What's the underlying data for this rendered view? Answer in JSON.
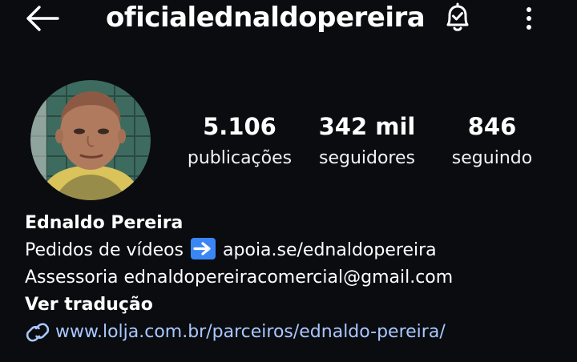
{
  "header": {
    "username": "oficialednaldopereira",
    "back_icon": "arrow-left-icon",
    "notification_icon": "bell-check-icon",
    "more_icon": "more-vertical-icon"
  },
  "profile": {
    "avatar_icon": "profile-photo",
    "stats": [
      {
        "value": "5.106",
        "label": "publicações"
      },
      {
        "value": "342 mil",
        "label": "seguidores"
      },
      {
        "value": "846",
        "label": "seguindo"
      }
    ]
  },
  "bio": {
    "name": "Ednaldo Pereira",
    "line1_before": "Pedidos de vídeos",
    "line1_emoji": "arrow-right-emoji",
    "line1_after": "apoia.se/ednaldopereira",
    "line2": "Assessoria ednaldopereiracomercial@gmail.com",
    "translate_label": "Ver tradução",
    "link_icon": "link-icon",
    "link": "www.lolja.com.br/parceiros/ednaldo-pereira/"
  },
  "colors": {
    "background": "#0b0c10",
    "text": "#ffffff",
    "link": "#a9c8ff",
    "emoji_blue": "#3a86f5"
  }
}
